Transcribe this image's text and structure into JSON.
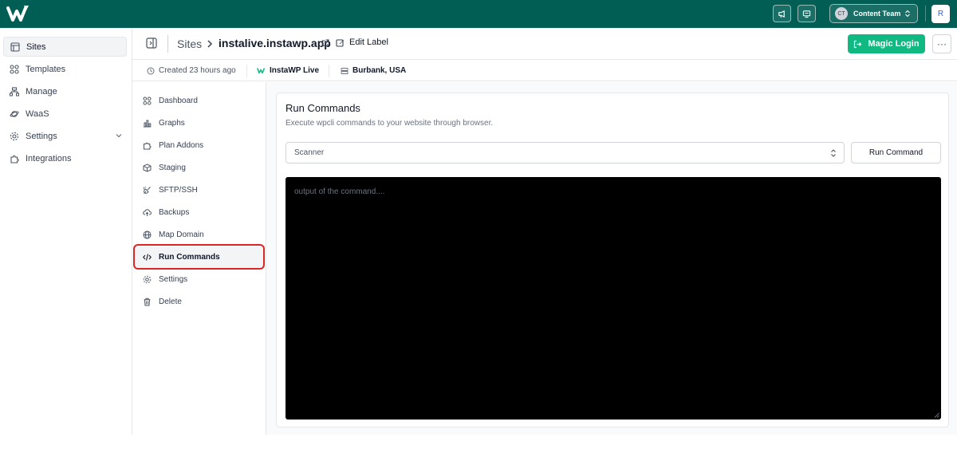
{
  "topbar": {
    "team_initials": "CT",
    "team_name": "Content Team",
    "user_initial": "R",
    "brand_color": "#005e54"
  },
  "sidebar": {
    "items": [
      {
        "label": "Sites",
        "icon": "layout-icon",
        "active": true
      },
      {
        "label": "Templates",
        "icon": "grid-icon"
      },
      {
        "label": "Manage",
        "icon": "sitemap-icon"
      },
      {
        "label": "WaaS",
        "icon": "planet-icon"
      },
      {
        "label": "Settings",
        "icon": "gear-icon",
        "expandable": true
      },
      {
        "label": "Integrations",
        "icon": "puzzle-icon"
      }
    ]
  },
  "header": {
    "crumb_sites": "Sites",
    "site_name": "instalive.instawp.app",
    "edit_label": "Edit Label",
    "magic_login": "Magic Login",
    "more": "···"
  },
  "meta": {
    "created": "Created 23 hours ago",
    "plan": "InstaWP Live",
    "location": "Burbank, USA"
  },
  "subnav": {
    "items": [
      {
        "label": "Dashboard",
        "icon": "grid-icon"
      },
      {
        "label": "Graphs",
        "icon": "bar-chart-icon"
      },
      {
        "label": "Plan Addons",
        "icon": "puzzle-icon"
      },
      {
        "label": "Staging",
        "icon": "box-icon"
      },
      {
        "label": "SFTP/SSH",
        "icon": "plug-icon"
      },
      {
        "label": "Backups",
        "icon": "cloud-upload-icon"
      },
      {
        "label": "Map Domain",
        "icon": "globe-icon"
      },
      {
        "label": "Run Commands",
        "icon": "code-icon",
        "active": true
      },
      {
        "label": "Settings",
        "icon": "gear-icon"
      },
      {
        "label": "Delete",
        "icon": "trash-icon"
      }
    ]
  },
  "main": {
    "title": "Run Commands",
    "subtitle": "Execute wpcli commands to your website through browser.",
    "selected_command": "Scanner",
    "run_button": "Run Command",
    "output_placeholder": "output of the command...."
  }
}
